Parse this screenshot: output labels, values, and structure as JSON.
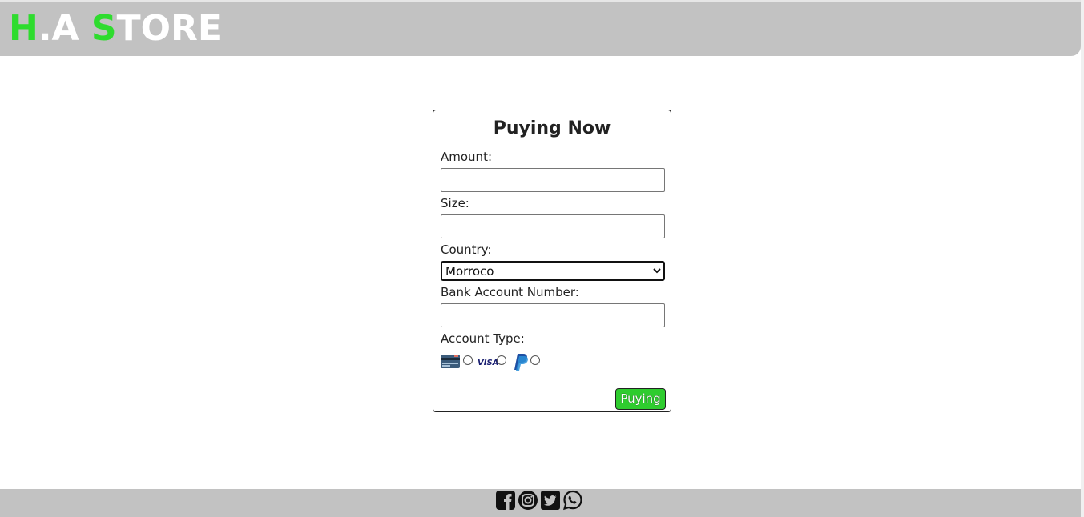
{
  "header": {
    "logo_h": "H",
    "logo_dot_a": ".A ",
    "logo_s": "S",
    "logo_tore": "TORE"
  },
  "form": {
    "title": "Puying Now",
    "amount_label": "Amount:",
    "size_label": "Size:",
    "country_label": "Country:",
    "country_value": "Morroco",
    "bank_label": "Bank Account Number:",
    "account_type_label": "Account Type:",
    "account_types": [
      "credit-card-icon",
      "visa-icon",
      "paypal-icon"
    ],
    "submit_label": "Puying"
  },
  "footer": {
    "social_icons": [
      "facebook-icon",
      "instagram-icon",
      "twitter-icon",
      "whatsapp-icon"
    ]
  },
  "colors": {
    "accent": "#2edc2e",
    "header_bg": "#c2c2c2",
    "button_bg": "#2ecc2e"
  }
}
